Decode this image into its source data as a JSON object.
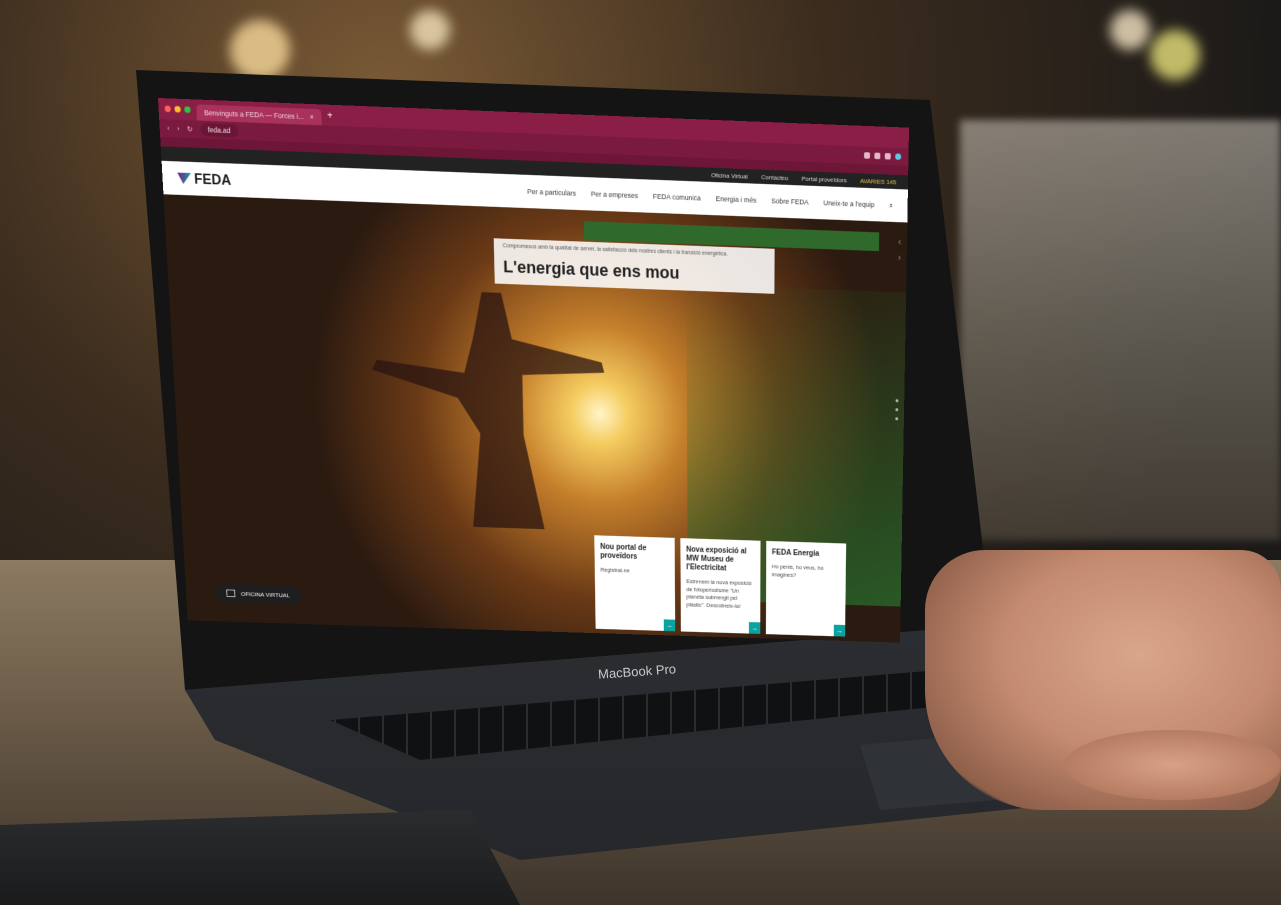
{
  "device": {
    "label": "MacBook Pro"
  },
  "browser": {
    "tab_title": "Benvinguts a FEDA — Forces i...",
    "url": "feda.ad"
  },
  "site": {
    "logo": "FEDA",
    "topbar": {
      "items": [
        "Oficina Virtual",
        "Contacteu",
        "Portal proveïdors"
      ],
      "avisos": "AVARIES 145"
    },
    "nav": {
      "items": [
        "Per a particulars",
        "Per a empreses",
        "FEDA comunica",
        "Energia i més",
        "Sobre FEDA",
        "Uneix-te a l'equip"
      ]
    },
    "hero": {
      "subtitle": "Compromesos amb la qualitat de servei, la satisfacció dels nostres clients i la transició energètica.",
      "title": "L'energia que ens mou"
    },
    "news": [
      {
        "title": "Nou portal de proveïdors",
        "text": "Registrat-ne"
      },
      {
        "title": "Nova exposició al MW Museu de l'Electricitat",
        "text": "Estrenem la nova exposició de fotoperiodisme \"Un planeta submergit pel plàstic\". Descobreix-la!"
      },
      {
        "title": "FEDA Energia",
        "text": "Ho penis, ho veus, ho imagines?"
      }
    ],
    "oficina_button": "OFICINA VIRTUAL"
  },
  "colors": {
    "browser_bar": "#8a1e47",
    "accent_teal": "#0aa3a0",
    "topbar_alert": "#e7c84a"
  }
}
